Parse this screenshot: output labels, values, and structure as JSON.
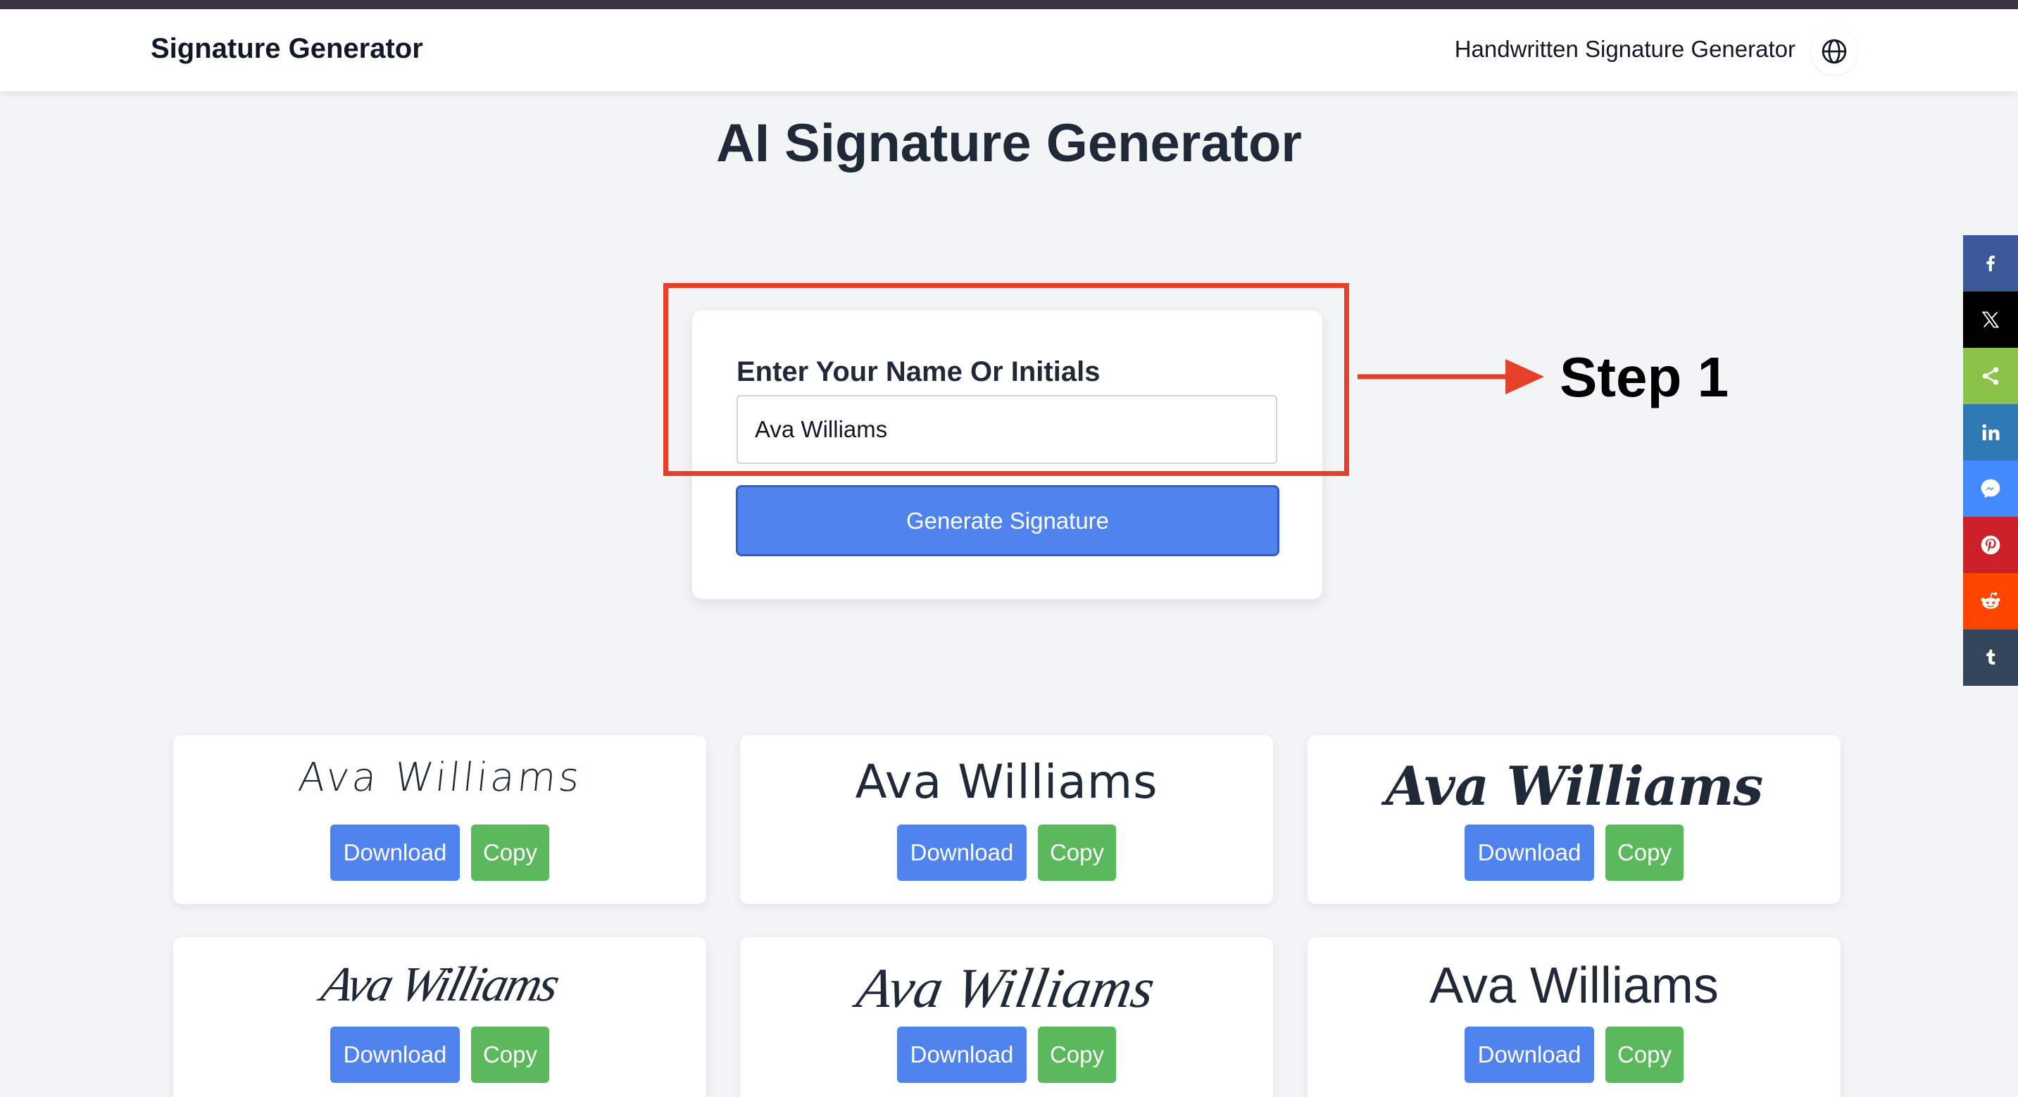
{
  "header": {
    "brand": "Signature Generator",
    "nav_link": "Handwritten Signature Generator",
    "language_icon": "globe-icon"
  },
  "page_title": "AI Signature Generator",
  "form": {
    "label": "Enter Your Name Or Initials",
    "input_value": "Ava Williams",
    "generate_label": "Generate Signature"
  },
  "annotation": {
    "step_label": "Step 1",
    "color": "#e5402a"
  },
  "share": [
    {
      "name": "facebook",
      "icon": "facebook-icon",
      "color": "#3b5998"
    },
    {
      "name": "x",
      "icon": "x-icon",
      "color": "#000000"
    },
    {
      "name": "share",
      "icon": "share-icon",
      "color": "#8bc34a"
    },
    {
      "name": "linkedin",
      "icon": "linkedin-icon",
      "color": "#2f79b5"
    },
    {
      "name": "messenger",
      "icon": "messenger-icon",
      "color": "#448aff"
    },
    {
      "name": "pinterest",
      "icon": "pinterest-icon",
      "color": "#cb2027"
    },
    {
      "name": "reddit",
      "icon": "reddit-icon",
      "color": "#ff4500"
    },
    {
      "name": "tumblr",
      "icon": "tumblr-icon",
      "color": "#35465c"
    }
  ],
  "signatures": [
    {
      "text": "Ava Williams",
      "download_label": "Download",
      "copy_label": "Copy"
    },
    {
      "text": "Ava Williams",
      "download_label": "Download",
      "copy_label": "Copy"
    },
    {
      "text": "Ava Williams",
      "download_label": "Download",
      "copy_label": "Copy"
    },
    {
      "text": "Ava Williams",
      "download_label": "Download",
      "copy_label": "Copy"
    },
    {
      "text": "Ava Williams",
      "download_label": "Download",
      "copy_label": "Copy"
    },
    {
      "text": "Ava Williams",
      "download_label": "Download",
      "copy_label": "Copy"
    }
  ],
  "colors": {
    "primary": "#4f83ed",
    "success": "#5cb85c",
    "background": "#f3f4f6"
  }
}
